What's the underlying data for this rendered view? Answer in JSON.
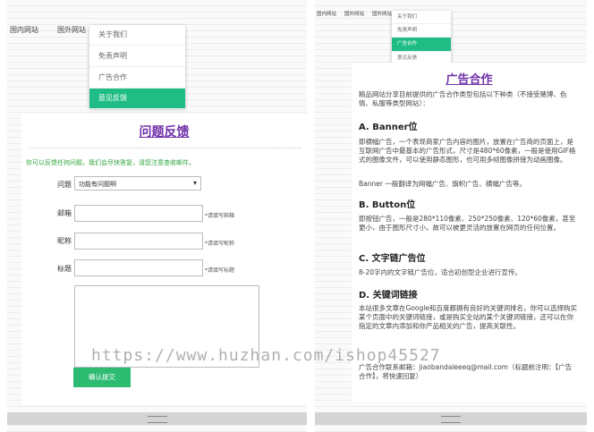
{
  "left": {
    "nav": [
      "国内网站",
      "国外网站"
    ],
    "menu": [
      "关于我们",
      "免责声明",
      "广告合作",
      "意见反馈"
    ],
    "title": "问题反馈",
    "notice": "你可以反馈任何问题，我们会尽快答复，请您注意查收邮件。",
    "form": {
      "type_label": "问题",
      "type_value": "功能有问题啊",
      "email_label": "邮箱",
      "email_hint": "*请填写邮箱",
      "nick_label": "昵称",
      "nick_hint": "*请填写昵称",
      "subject_label": "标题",
      "subject_hint": "*请填写标题",
      "submit_label": "确认提交"
    }
  },
  "right": {
    "nav": [
      "国内网站",
      "国外网站",
      "国外网站"
    ],
    "menu": [
      "关于我们",
      "免责声明",
      "广告合作",
      "意见反馈"
    ],
    "title": "广告合作",
    "intro": "精品网站分享目前提供的广告合作类型包括以下种类（不接受赌博、色情、私服等类型网站）：",
    "sections": [
      {
        "heading": "A. Banner位",
        "text": "即横幅广告，一个表现商家广告内容的图片，放置在广告商的页面上，是互联网广告中最基本的广告形式，尺寸是480*60像素，一般是使用GIF格式的图像文件，可以使用静态图形，也可用多帧图像拼接为动画图像。"
      },
      {
        "heading": "",
        "text": "Banner 一般翻译为网幅广告、旗帜广告、横幅广告等。"
      },
      {
        "heading": "B. Button位",
        "text": "即按钮广告，一般是280*110像素、250*250像素、120*60像素，甚至更小，由于图形尺寸小，故可以被更灵活的放置在网页的任何位置。"
      },
      {
        "heading": "C. 文字链广告位",
        "text": "8-20字内的文字链广告位，适合初创型企业进行宣传。"
      },
      {
        "heading": "D. 关键词链接",
        "text": "本站很多文章在Google和百度都拥有良好的关键词排名，你可以选择购买某个页面中的关键词链接，或是购买全站的某个关键词链接，还可以在你指定的文章内添加和你产品相关的广告，提高关联性。"
      }
    ],
    "contact": "广告合作联系邮箱：jiaobandaleeeq@mail.com（标题前注明：【广告合作】，将快速回复）"
  },
  "watermark": "https://www.huzhan.com/ishop45527"
}
